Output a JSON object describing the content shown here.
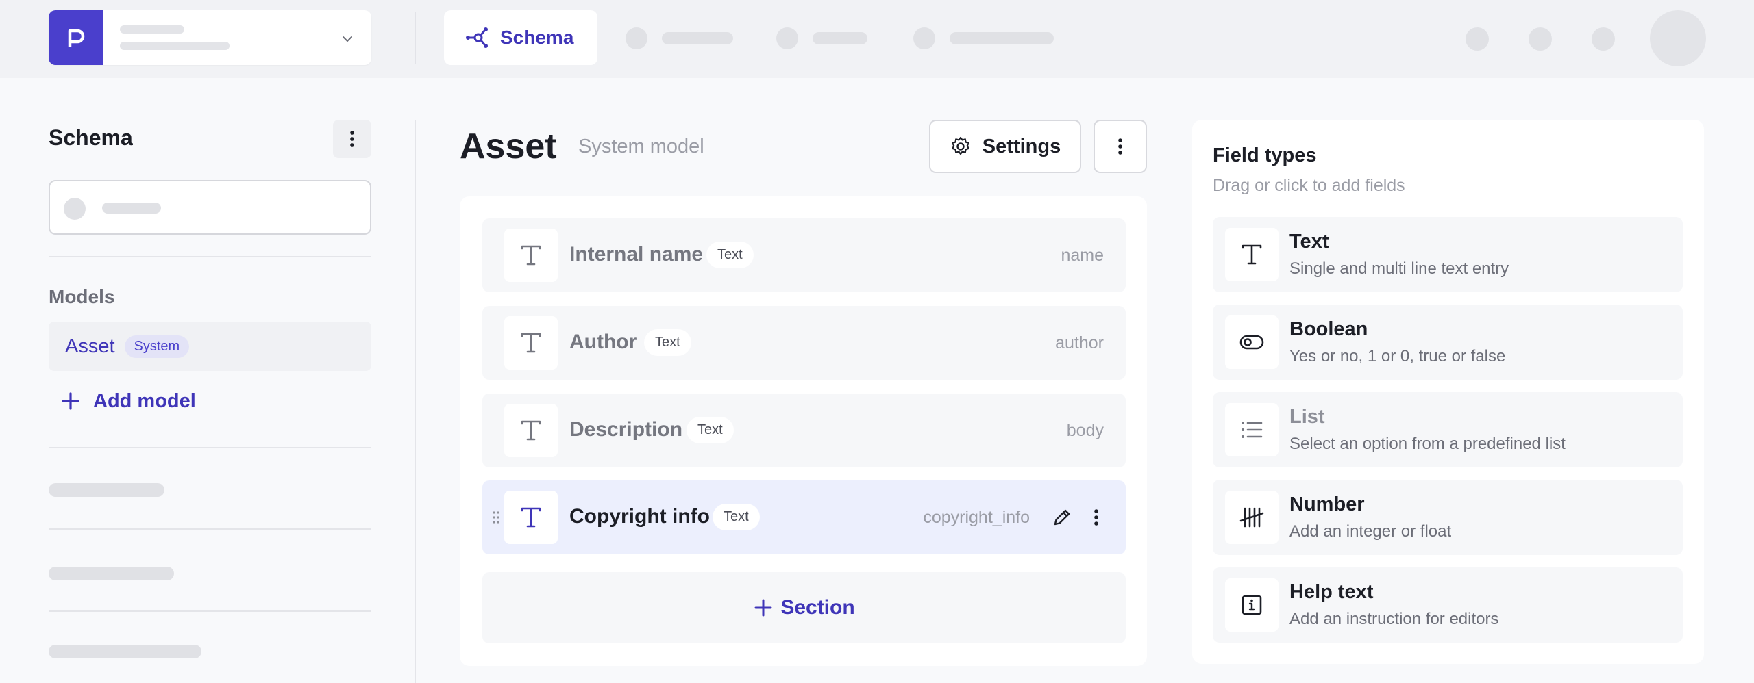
{
  "topbar": {
    "active_tab": "Schema"
  },
  "sidebar": {
    "title": "Schema",
    "models_label": "Models",
    "models": [
      {
        "label": "Asset",
        "badge": "System"
      }
    ],
    "add_model_label": "Add model"
  },
  "main": {
    "model_title": "Asset",
    "model_subtitle": "System model",
    "settings_label": "Settings",
    "fields": [
      {
        "name": "Internal name",
        "type": "Text",
        "api_id": "name"
      },
      {
        "name": "Author",
        "type": "Text",
        "api_id": "author"
      },
      {
        "name": "Description",
        "type": "Text",
        "api_id": "body"
      },
      {
        "name": "Copyright info",
        "type": "Text",
        "api_id": "copyright_info"
      }
    ],
    "section_label": "Section"
  },
  "field_types": {
    "title": "Field types",
    "subtitle": "Drag or click to add fields",
    "items": [
      {
        "name": "Text",
        "description": "Single and multi line text entry",
        "icon": "text-icon"
      },
      {
        "name": "Boolean",
        "description": "Yes or no, 1 or 0, true or false",
        "icon": "toggle-icon"
      },
      {
        "name": "List",
        "description": "Select an option from a predefined list",
        "icon": "list-icon"
      },
      {
        "name": "Number",
        "description": "Add an integer or float",
        "icon": "tally-icon"
      },
      {
        "name": "Help text",
        "description": "Add an instruction for editors",
        "icon": "info-icon"
      }
    ]
  },
  "colors": {
    "accent": "#4a3fcc",
    "accent_text": "#3f35b8",
    "active_row": "#eceffd"
  }
}
